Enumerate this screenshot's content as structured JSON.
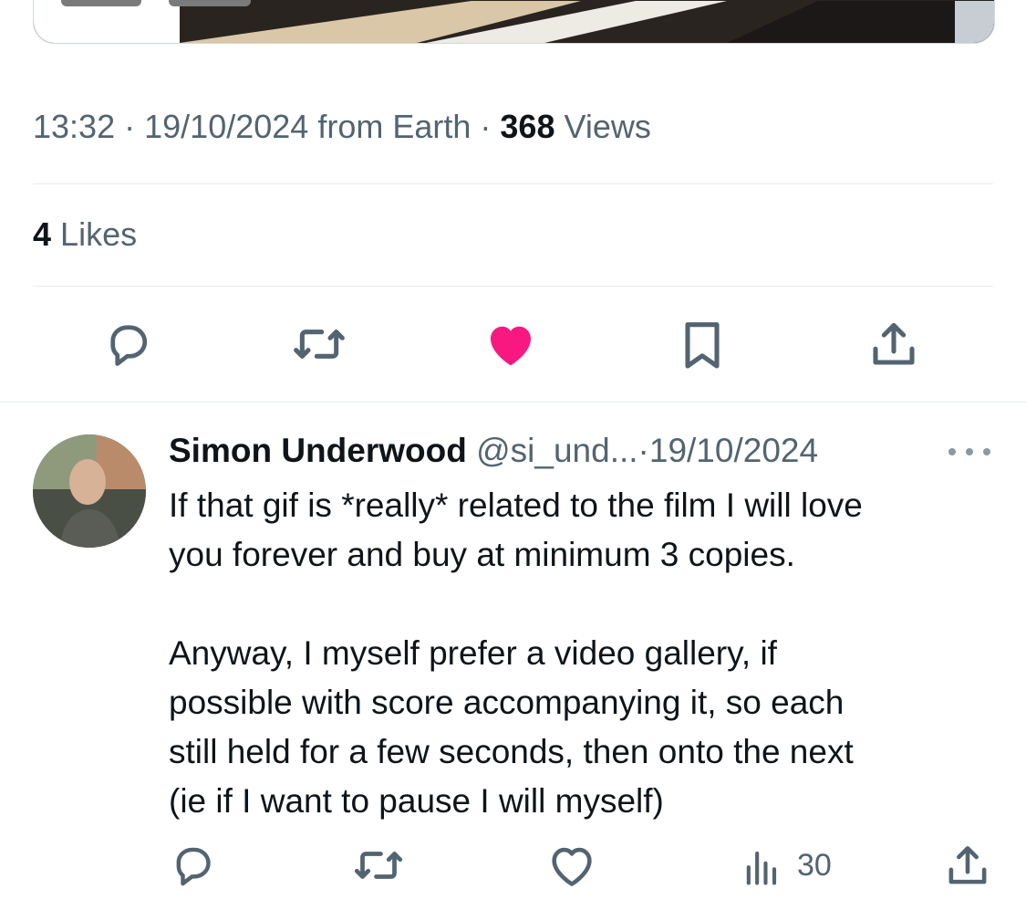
{
  "tweet": {
    "time": "13:32",
    "date": "19/10/2024",
    "source": "from Earth",
    "views_count": "368",
    "views_label": "Views",
    "likes_count": "4",
    "likes_label": "Likes",
    "actions": [
      {
        "name": "reply",
        "icon": "reply-icon"
      },
      {
        "name": "retweet",
        "icon": "retweet-icon"
      },
      {
        "name": "like",
        "icon": "heart-filled-icon",
        "active": true
      },
      {
        "name": "bookmark",
        "icon": "bookmark-icon"
      },
      {
        "name": "share",
        "icon": "share-icon"
      }
    ]
  },
  "reply": {
    "author_name": "Simon Underwood",
    "author_handle": "@si_und...",
    "date": "19/10/2024",
    "text": "If that gif is *really* related to the film I will love\nyou forever and buy at minimum 3 copies.\n\nAnyway, I myself prefer a video gallery, if\npossible with score accompanying it, so each\nstill held for a few seconds, then onto the next\n(ie if I want to pause I will myself)",
    "views_count": "30"
  },
  "colors": {
    "text": "#0f1419",
    "secondary": "#536471",
    "like": "#f91880",
    "divider": "#e6ecf0"
  }
}
